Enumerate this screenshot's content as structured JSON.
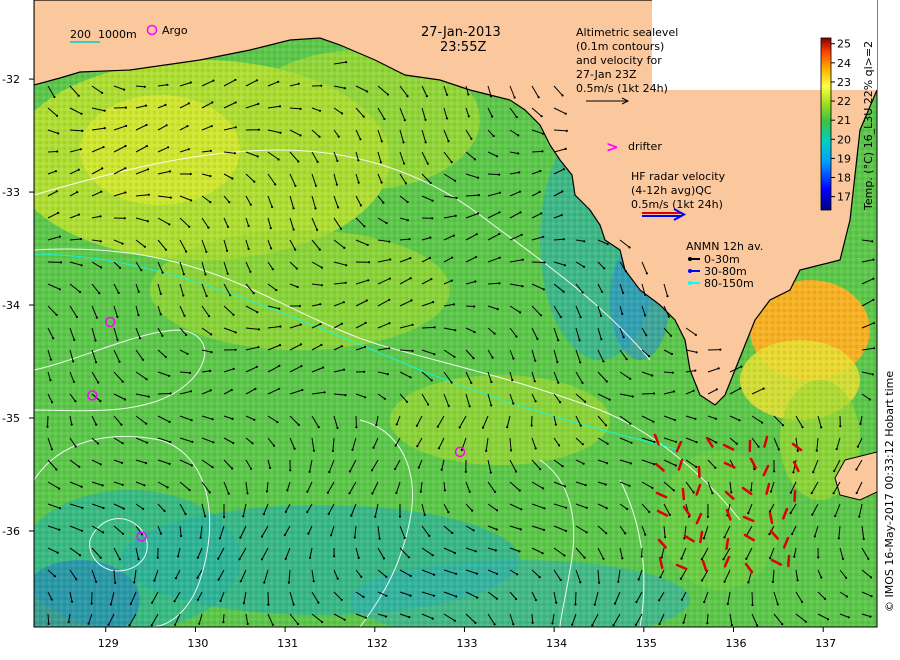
{
  "title": {
    "date": "27-Jan-2013",
    "time": "23:55Z"
  },
  "scale_bar": {
    "label_a": "200",
    "label_b": "1000m"
  },
  "argo_legend": {
    "label": "Argo"
  },
  "altimetry_legend": {
    "lines": [
      "Altimetric sealevel",
      "(0.1m contours)",
      "and velocity for",
      "27-Jan 23Z",
      "0.5m/s (1kt 24h)"
    ]
  },
  "drifter_legend": {
    "symbol": ">",
    "label": "drifter"
  },
  "hf_radar_legend": {
    "lines": [
      "HF radar velocity",
      "(4-12h avg)QC",
      "0.5m/s (1kt 24h)"
    ]
  },
  "anmn_legend": {
    "title": "ANMN 12h av.",
    "items": [
      {
        "label": "0-30m",
        "color": "#000000"
      },
      {
        "label": "30-80m",
        "color": "#0000ff"
      },
      {
        "label": "80-150m",
        "color": "#00ffff"
      }
    ]
  },
  "colorbar": {
    "label": "Temp. (°C) 16_L3U 22% ql>=2",
    "ticks": [
      "25",
      "24",
      "23",
      "22",
      "21",
      "20",
      "19",
      "18",
      "17"
    ],
    "min": 16.3,
    "max": 25.3
  },
  "credit": "© IMOS 16-May-2017 00:33:12 Hobart time",
  "axes": {
    "x_ticks": [
      "129",
      "130",
      "131",
      "132",
      "133",
      "134",
      "135",
      "136",
      "137"
    ],
    "y_ticks": [
      "-32",
      "-33",
      "-34",
      "-35",
      "-36"
    ],
    "lon_range": [
      128.2,
      137.6
    ],
    "lat_range": [
      -36.85,
      -31.3
    ]
  },
  "argo_floats": [
    {
      "lon": 129.05,
      "lat": -34.15
    },
    {
      "lon": 128.85,
      "lat": -34.8
    },
    {
      "lon": 129.4,
      "lat": -36.05
    },
    {
      "lon": 132.95,
      "lat": -35.3
    }
  ],
  "colors": {
    "land": "#fbc89e",
    "coast": "#000000",
    "contour": "#ffffff",
    "argo": "#ff00ff",
    "hf_radar": "#dd0000",
    "drifter": "#ff00ff"
  }
}
